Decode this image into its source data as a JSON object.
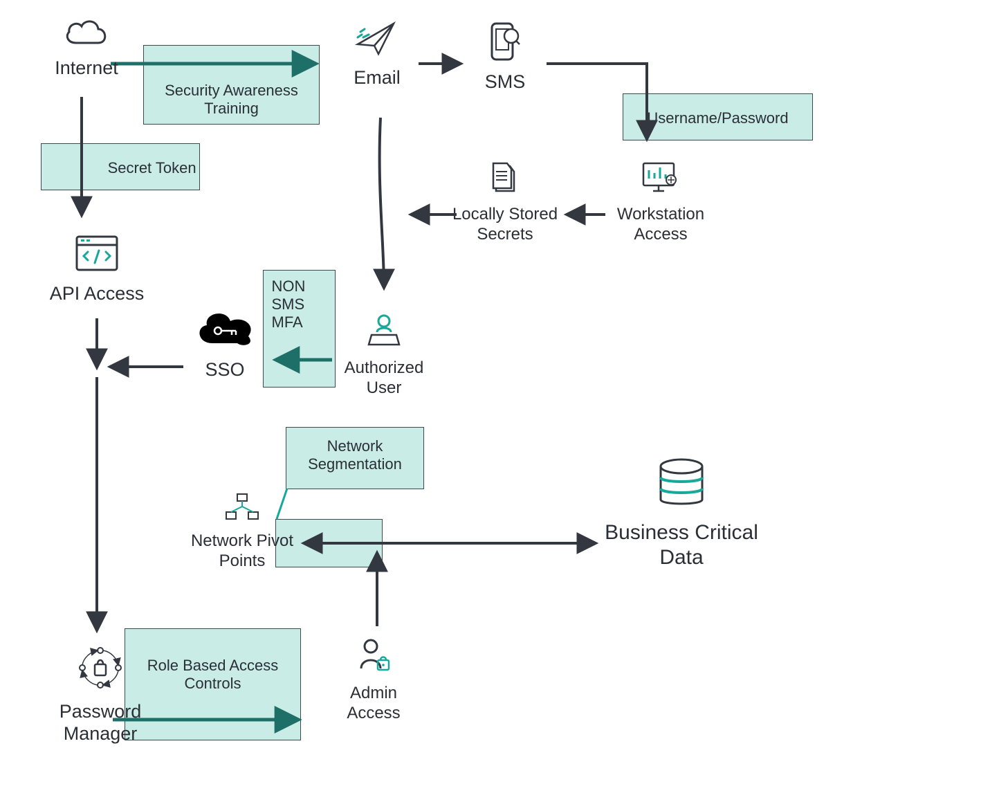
{
  "nodes": {
    "internet": "Internet",
    "email": "Email",
    "sms": "SMS",
    "username_password": "Username/Password",
    "workstation_access": "Workstation\nAccess",
    "locally_stored_secrets": "Locally\nStored Secrets",
    "api_access": "API Access",
    "sso": "SSO",
    "authorized_user": "Authorized\nUser",
    "network_pivot_points": "Network\nPivot Points",
    "admin_access": "Admin\nAccess",
    "password_manager": "Password\nManager",
    "business_critical_data": "Business\nCritical Data"
  },
  "controls": {
    "security_awareness_training": "Security Awareness\nTraining",
    "secret_token": "Secret Token",
    "non_sms_mfa": "NON\nSMS\nMFA",
    "network_segmentation": "Network\nSegmentation",
    "rbac": "Role Based Access\nControls"
  },
  "colors": {
    "stroke_dark": "#333840",
    "stroke_teal": "#1f6f69",
    "teal": "#17a79b",
    "box_fill": "#c9ece7"
  }
}
